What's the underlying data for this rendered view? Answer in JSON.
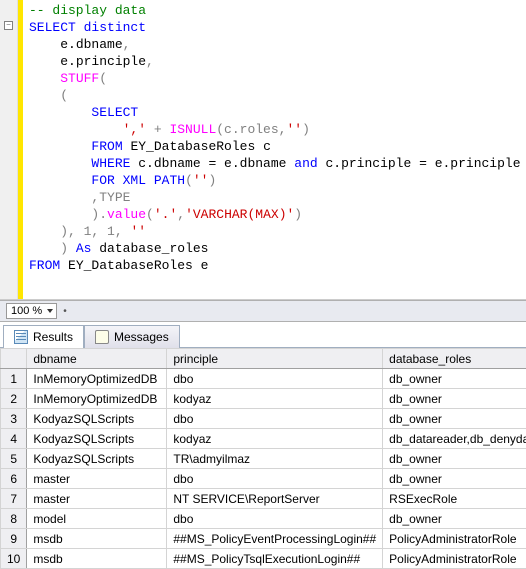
{
  "zoom": "100 %",
  "code": {
    "comment": "-- display data",
    "kw_select": "SELECT",
    "kw_distinct": "distinct",
    "col1": "e.dbname",
    "col2": "e.principle",
    "stuff": "STUFF",
    "open1": "(",
    "open2": "(",
    "inner_select": "SELECT",
    "comma_lit": "','",
    "plus": " + ",
    "isnull": "ISNULL",
    "isnull_args_open": "(c.roles,",
    "empty_lit": "''",
    "isnull_close": ")",
    "from": "FROM",
    "from_tbl": " EY_DatabaseRoles c",
    "where": "WHERE",
    "where1": " c.dbname = e.dbname ",
    "and": "and",
    "where2": " c.principle = e.principle",
    "for": "FOR",
    "xml": " XML ",
    "path": "PATH",
    "path_arg_open": "(",
    "path_lit": "''",
    "path_arg_close": ")",
    "type": ",TYPE",
    "close_inner": ").",
    "value_fn": "value",
    "value_open": "(",
    "dot_lit": "'.'",
    "value_sep": ",",
    "varchar_lit": "'VARCHAR(MAX)'",
    "value_close": ")",
    "stuff_tail": ", 1, 1, ",
    "stuff_tail_lit": "''",
    "close2": ")",
    "as": "As",
    "alias": " database_roles",
    "outer_from": "FROM",
    "outer_tbl": " EY_DatabaseRoles e"
  },
  "tabs": {
    "results": "Results",
    "messages": "Messages"
  },
  "columns": {
    "c1": "dbname",
    "c2": "principle",
    "c3": "database_roles"
  },
  "rows": [
    {
      "n": "1",
      "dbname": "InMemoryOptimizedDB",
      "principle": "dbo",
      "roles": "db_owner"
    },
    {
      "n": "2",
      "dbname": "InMemoryOptimizedDB",
      "principle": "kodyaz",
      "roles": "db_owner"
    },
    {
      "n": "3",
      "dbname": "KodyazSQLScripts",
      "principle": "dbo",
      "roles": "db_owner"
    },
    {
      "n": "4",
      "dbname": "KodyazSQLScripts",
      "principle": "kodyaz",
      "roles": "db_datareader,db_denydatawriter"
    },
    {
      "n": "5",
      "dbname": "KodyazSQLScripts",
      "principle": "TR\\admyilmaz",
      "roles": "db_owner"
    },
    {
      "n": "6",
      "dbname": "master",
      "principle": "dbo",
      "roles": "db_owner"
    },
    {
      "n": "7",
      "dbname": "master",
      "principle": "NT SERVICE\\ReportServer",
      "roles": "RSExecRole"
    },
    {
      "n": "8",
      "dbname": "model",
      "principle": "dbo",
      "roles": "db_owner"
    },
    {
      "n": "9",
      "dbname": "msdb",
      "principle": "##MS_PolicyEventProcessingLogin##",
      "roles": "PolicyAdministratorRole"
    },
    {
      "n": "10",
      "dbname": "msdb",
      "principle": "##MS_PolicyTsqlExecutionLogin##",
      "roles": "PolicyAdministratorRole"
    }
  ]
}
